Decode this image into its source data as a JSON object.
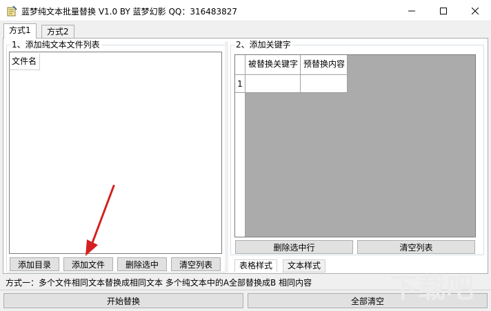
{
  "window": {
    "title": "蓝梦纯文本批量替换 V1.0 BY 蓝梦幻影 QQ：316483827"
  },
  "tabs": [
    {
      "label": "方式1",
      "active": true
    },
    {
      "label": "方式2",
      "active": false
    }
  ],
  "file_panel": {
    "title": "1、添加纯文本文件列表",
    "column": "文件名",
    "buttons": {
      "add_dir": "添加目录",
      "add_file": "添加文件",
      "delete_selected": "删除选中",
      "clear_list": "清空列表"
    }
  },
  "keyword_panel": {
    "title": "2、添加关键字",
    "columns": [
      "被替换关键字",
      "预替换内容"
    ],
    "rows": [
      {
        "index": "1",
        "keyword": "",
        "replacement": ""
      }
    ],
    "buttons": {
      "delete_row": "删除选中行",
      "clear_list": "清空列表"
    },
    "sub_tabs": [
      "表格样式",
      "文本样式"
    ]
  },
  "status": {
    "text": "方式一：多个文件相同文本替换成相同文本  多个纯文本中的A全部替换成B 相同内容"
  },
  "footer": {
    "start": "开始替换",
    "clear_all": "全部清空"
  },
  "watermark": "下载吧",
  "colors": {
    "arrow": "#d42020",
    "window_bg": "#f0f0f0",
    "button_bg": "#e1e1e1"
  }
}
